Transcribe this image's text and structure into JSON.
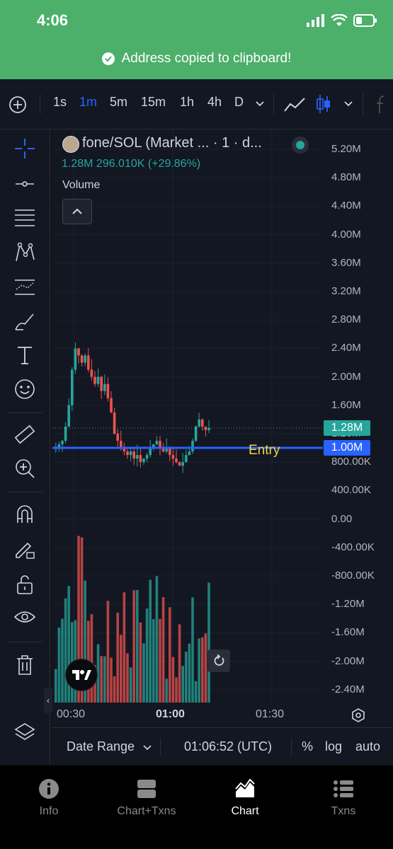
{
  "status_bar": {
    "time": "4:06"
  },
  "toast": {
    "message": "Address copied to clipboard!"
  },
  "toolbar": {
    "intervals": [
      "1s",
      "1m",
      "5m",
      "15m",
      "1h",
      "4h",
      "D"
    ],
    "active_interval": "1m"
  },
  "chart": {
    "symbol_title": "fone/SOL (Market ... · 1 · d...",
    "legend_values": "1.28M  296.010K (+29.86%)",
    "volume_label": "Volume",
    "price_axis": [
      "5.20M",
      "4.80M",
      "4.40M",
      "4.00M",
      "3.60M",
      "3.20M",
      "2.80M",
      "2.40M",
      "2.00M",
      "1.60M",
      "1.20M",
      "800.00K",
      "400.00K",
      "0.00",
      "-400.00K",
      "-800.00K",
      "-1.20M",
      "-1.60M",
      "-2.00M",
      "-2.40M"
    ],
    "last_price_tag": "1.28M",
    "entry_price_tag": "1.00M",
    "entry_label": "Entry",
    "colors": {
      "up": "#26a69a",
      "down": "#ef5350",
      "entry_line": "#2962ff",
      "entry_text": "#f5d442"
    }
  },
  "chart_data": {
    "type": "candlestick",
    "title": "fone/SOL (Market ... · 1 · d...",
    "last": 1280000,
    "change": 296010,
    "change_pct": 29.86,
    "entry_level": 1000000,
    "ylim": [
      -2600000,
      5400000
    ]
  },
  "time_axis": {
    "labels": [
      "00:30",
      "01:00",
      "01:30"
    ]
  },
  "chart_footer": {
    "date_range": "Date Range",
    "clock": "01:06:52 (UTC)",
    "percent": "%",
    "log": "log",
    "auto": "auto"
  },
  "bottom_nav": {
    "items": [
      "Info",
      "Chart+Txns",
      "Chart",
      "Txns"
    ],
    "active": "Chart"
  }
}
